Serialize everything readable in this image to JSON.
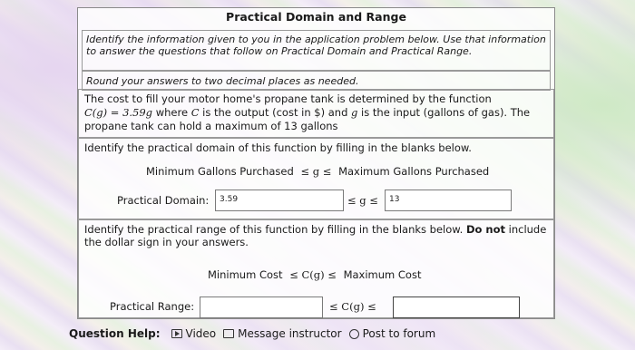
{
  "title": "Practical Domain and Range",
  "instructions": "Identify the information given to you in the application problem below. Use that information to answer the questions that follow on Practical Domain and Practical Range.",
  "rounding_note": "Round your answers to two decimal places as needed.",
  "problem": {
    "line1": "The cost to fill your motor home's propane tank is determined by the function",
    "formula": "C(g) = 3.59g",
    "line2_mid": " where ",
    "var_c": "C",
    "line2_rest": " is the output (cost in $) and ",
    "var_g": "g",
    "line2_end": " is the input (gallons of gas). The",
    "line3": "propane tank can hold a maximum of 13 gallons"
  },
  "domain_question": {
    "prompt": "Identify the practical domain of this function by filling in the blanks below.",
    "template_left": "Minimum Gallons Purchased",
    "template_mid": "≤ g ≤",
    "template_right": "Maximum Gallons Purchased",
    "label": "Practical Domain:",
    "min_value": "3.59",
    "between": "≤ g ≤",
    "max_value": "13"
  },
  "range_question": {
    "prompt_a": "Identify the practical range of this function by filling in the blanks below. ",
    "prompt_bold": "Do not",
    "prompt_b": " include the dollar sign in your answers.",
    "template_left": "Minimum Cost",
    "template_mid": "≤ C(g) ≤",
    "template_right": "Maximum Cost",
    "label": "Practical Range:",
    "min_value": "",
    "between": "≤ C(g) ≤",
    "max_value": ""
  },
  "help": {
    "label": "Question Help:",
    "video": "Video",
    "message": "Message instructor",
    "forum": "Post to forum"
  }
}
